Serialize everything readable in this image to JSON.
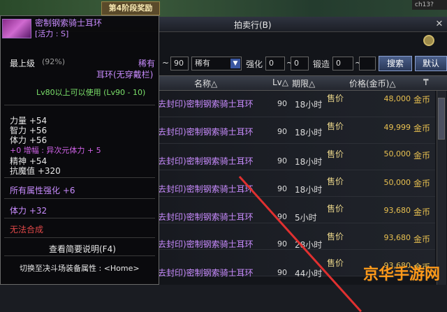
{
  "topbar": {
    "phase": "第4阶段奖励",
    "channel": "ch13?"
  },
  "window": {
    "title": "拍卖行(B)"
  },
  "filters": {
    "lv_to": "90",
    "rarity": "稀有",
    "enhance_label": "强化",
    "enhance_from": "0",
    "enhance_to": "0",
    "forge_label": "锻造",
    "forge_from": "0",
    "search_button": "搜索",
    "default_button": "默认"
  },
  "table": {
    "headers": {
      "name": "名称△",
      "lv": "Lv△",
      "expiry": "期限△",
      "price": "价格(金币)△"
    },
    "rows": [
      {
        "name": "去封印)密制钢索骑士耳环",
        "lv": "90",
        "expiry": "18小时",
        "kind": "售价",
        "price": "48,000",
        "currency": "金币"
      },
      {
        "name": "去封印)密制钢索骑士耳环",
        "lv": "90",
        "expiry": "18小时",
        "kind": "售价",
        "price": "49,999",
        "currency": "金币"
      },
      {
        "name": "去封印)密制钢索骑士耳环",
        "lv": "90",
        "expiry": "18小时",
        "kind": "售价",
        "price": "50,000",
        "currency": "金币"
      },
      {
        "name": "去封印)密制钢索骑士耳环",
        "lv": "90",
        "expiry": "18小时",
        "kind": "售价",
        "price": "50,000",
        "currency": "金币"
      },
      {
        "name": "去封印)密制钢索骑士耳环",
        "lv": "90",
        "expiry": "5小时",
        "kind": "售价",
        "price": "93,680",
        "currency": "金币"
      },
      {
        "name": "去封印)密制钢索骑士耳环",
        "lv": "90",
        "expiry": "28小时",
        "kind": "售价",
        "price": "93,680",
        "currency": "金币"
      },
      {
        "name": "去封印)密制钢索骑士耳环",
        "lv": "90",
        "expiry": "44小时",
        "kind": "售价",
        "price": "93,680",
        "currency": "金币"
      }
    ]
  },
  "tooltip": {
    "item_name": "密制钢索骑士耳环",
    "vitality": "[活力 : S]",
    "grade": "最上级",
    "grade_pct": "(92%)",
    "rarity": "稀有",
    "slot": "耳环(无穿戴栏)",
    "level_req": "Lv80以上可以使用 (Lv90 - 10)",
    "stats": [
      {
        "text": "力量 +54"
      },
      {
        "text": "智力 +56"
      },
      {
        "text": "体力 +56"
      }
    ],
    "amplify": "+0 增幅 : 异次元体力 + 5",
    "stats2": [
      {
        "text": "精神 +54"
      },
      {
        "text": "抗魔值 +320"
      }
    ],
    "all_attr": "所有属性强化 +6",
    "vit_bonus": "体力 +32",
    "no_synth": "无法合成",
    "view_brief": "查看简要说明(F4)",
    "switch": "切换至决斗场装备属性 : <Home>"
  },
  "watermark": "京华手游网",
  "colors": {
    "accent_purple": "#c98cff",
    "gold": "#e8c050",
    "green": "#7be06a",
    "amplify": "#d062e8",
    "warn_red": "#e04848"
  }
}
